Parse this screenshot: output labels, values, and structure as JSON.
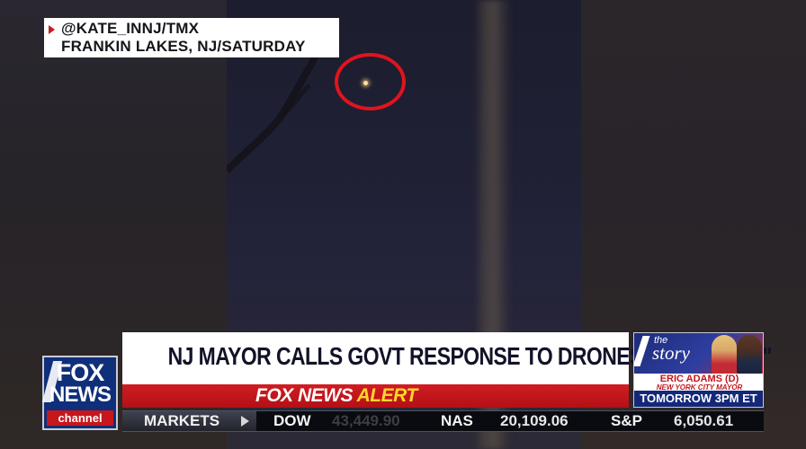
{
  "video": {
    "credit_line1": "@KATE_INNJ/TMX",
    "credit_line2": "FRANKIN LAKES, NJ/SATURDAY"
  },
  "logo": {
    "fox": "FOX",
    "news": "NEWS",
    "channel": "channel"
  },
  "lower_third": {
    "headline": "NJ MAYOR CALLS GOVT RESPONSE TO DRONES \"INSULTING\"",
    "alert_prefix": "FOX NEWS",
    "alert_word": "ALERT"
  },
  "promo": {
    "the": "the",
    "story": "story",
    "guest_name": "ERIC ADAMS (D)",
    "guest_title": "NEW YORK CITY MAYOR",
    "airtime": "TOMORROW 3PM ET"
  },
  "ticker": {
    "markets_label": "MARKETS",
    "items": [
      {
        "name": "DOW",
        "value": "43,449.90"
      },
      {
        "name": "NAS",
        "value": "20,109.06"
      },
      {
        "name": "S&P",
        "value": "6,050.61"
      }
    ]
  },
  "colors": {
    "alert_red": "#c41d22",
    "alert_yellow": "#ffd62b",
    "fox_blue": "#0f2f7a",
    "drone_circle": "#e0141d"
  }
}
